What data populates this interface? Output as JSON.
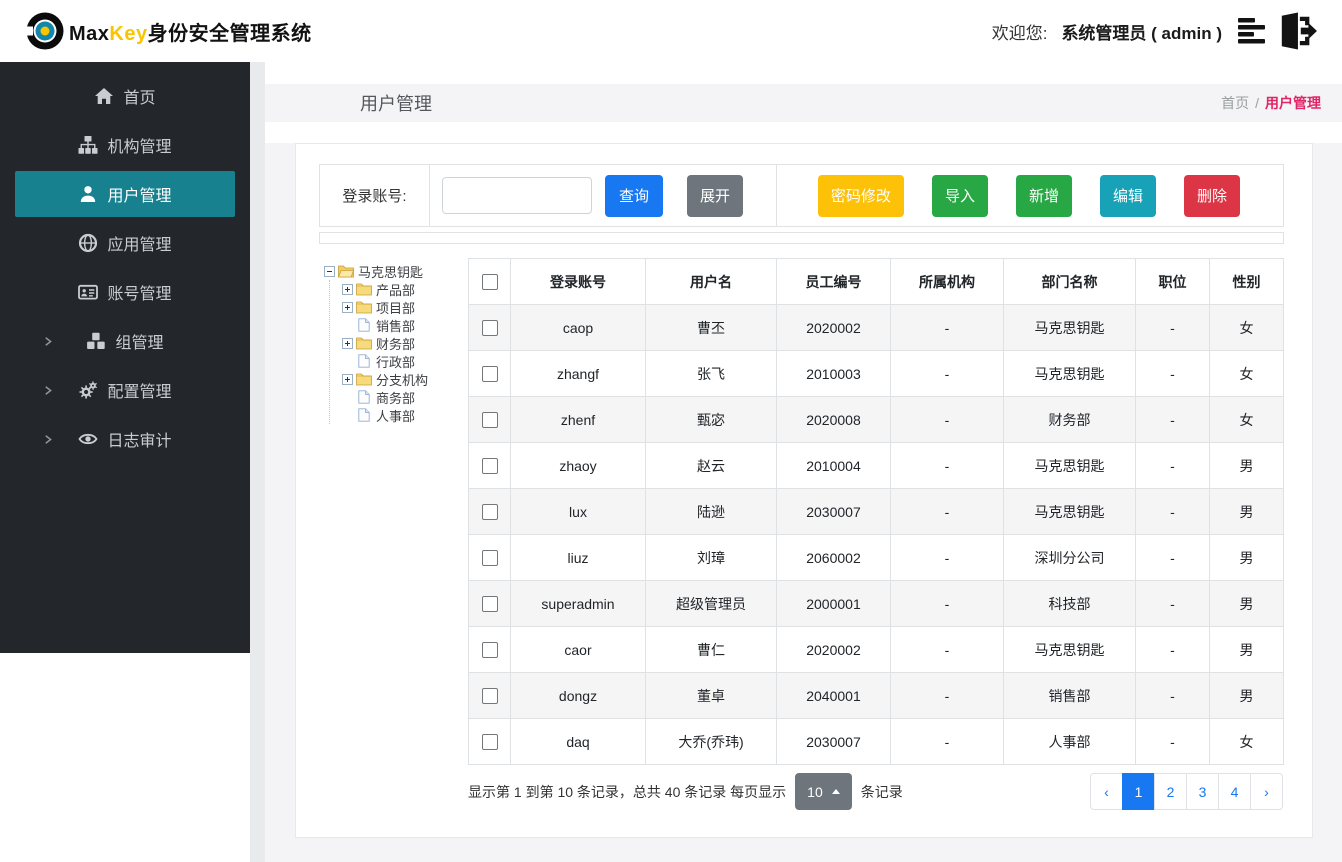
{
  "colors": {
    "brand_gold": "#f9c400",
    "logo_teal": "#1287a8",
    "logo_yellow": "#f9c400",
    "sidebar_bg": "#23272b",
    "sidebar_active": "#17818f",
    "primary_blue": "#1778f2",
    "secondary_gray": "#6e757d",
    "warning_yellow": "#fdc107",
    "success_green": "#28a745",
    "info_teal": "#17a2b8",
    "danger_red": "#dc3545",
    "breadcrumb_active": "#e02566",
    "band_bg": "#f4f4f6",
    "wrapper_bg": "#f4f4f6",
    "stripe_bg": "#f5f5f6"
  },
  "header": {
    "brand": {
      "max": "Max",
      "key": "Key",
      "suffix": "身份安全管理系统"
    },
    "welcome_label": "欢迎您:",
    "user": "系统管理员 ( admin )",
    "icons": [
      "menu-lines-icon",
      "logout-icon"
    ]
  },
  "sidebar": {
    "items": [
      {
        "key": "home",
        "label": "首页",
        "icon": "home-icon",
        "active": false,
        "has_submenu": false
      },
      {
        "key": "org",
        "label": "机构管理",
        "icon": "sitemap-icon",
        "active": false,
        "has_submenu": false
      },
      {
        "key": "user",
        "label": "用户管理",
        "icon": "user-icon",
        "active": true,
        "has_submenu": false
      },
      {
        "key": "app",
        "label": "应用管理",
        "icon": "globe-icon",
        "active": false,
        "has_submenu": false
      },
      {
        "key": "account",
        "label": "账号管理",
        "icon": "id-card-icon",
        "active": false,
        "has_submenu": false
      },
      {
        "key": "group",
        "label": "组管理",
        "icon": "cubes-icon",
        "active": false,
        "has_submenu": true
      },
      {
        "key": "config",
        "label": "配置管理",
        "icon": "gears-icon",
        "active": false,
        "has_submenu": true
      },
      {
        "key": "audit",
        "label": "日志审计",
        "icon": "eye-icon",
        "active": false,
        "has_submenu": true
      }
    ]
  },
  "page": {
    "title": "用户管理",
    "breadcrumb": {
      "home": "首页",
      "separator": "/",
      "current": "用户管理"
    }
  },
  "toolbar": {
    "search_label": "登录账号:",
    "search_value": "",
    "query_label": "查询",
    "expand_label": "展开",
    "actions": [
      {
        "key": "password-change",
        "label": "密码修改",
        "color": "#fdc107"
      },
      {
        "key": "import",
        "label": "导入",
        "color": "#28a745"
      },
      {
        "key": "add",
        "label": "新增",
        "color": "#28a745"
      },
      {
        "key": "edit",
        "label": "编辑",
        "color": "#17a2b8"
      },
      {
        "key": "delete",
        "label": "删除",
        "color": "#dc3545"
      }
    ]
  },
  "tree": {
    "nodes": [
      {
        "label": "马克思钥匙",
        "icon": "folder-open-icon",
        "expander": "minus",
        "level": 0
      },
      {
        "label": "产品部",
        "icon": "folder-icon",
        "expander": "plus",
        "level": 1
      },
      {
        "label": "项目部",
        "icon": "folder-icon",
        "expander": "plus",
        "level": 1
      },
      {
        "label": "销售部",
        "icon": "file-icon",
        "expander": "none",
        "level": 1
      },
      {
        "label": "财务部",
        "icon": "folder-icon",
        "expander": "plus",
        "level": 1
      },
      {
        "label": "行政部",
        "icon": "file-icon",
        "expander": "none",
        "level": 1
      },
      {
        "label": "分支机构",
        "icon": "folder-icon",
        "expander": "plus",
        "level": 1
      },
      {
        "label": "商务部",
        "icon": "file-icon",
        "expander": "none",
        "level": 1
      },
      {
        "label": "人事部",
        "icon": "file-icon",
        "expander": "none",
        "level": 1
      }
    ]
  },
  "table": {
    "columns": [
      "登录账号",
      "用户名",
      "员工编号",
      "所属机构",
      "部门名称",
      "职位",
      "性别"
    ],
    "rows": [
      [
        "caop",
        "曹丕",
        "2020002",
        "-",
        "马克思钥匙",
        "-",
        "女"
      ],
      [
        "zhangf",
        "张飞",
        "2010003",
        "-",
        "马克思钥匙",
        "-",
        "女"
      ],
      [
        "zhenf",
        "甄宓",
        "2020008",
        "-",
        "财务部",
        "-",
        "女"
      ],
      [
        "zhaoy",
        "赵云",
        "2010004",
        "-",
        "马克思钥匙",
        "-",
        "男"
      ],
      [
        "lux",
        "陆逊",
        "2030007",
        "-",
        "马克思钥匙",
        "-",
        "男"
      ],
      [
        "liuz",
        "刘璋",
        "2060002",
        "-",
        "深圳分公司",
        "-",
        "男"
      ],
      [
        "superadmin",
        "超级管理员",
        "2000001",
        "-",
        "科技部",
        "-",
        "男"
      ],
      [
        "caor",
        "曹仁",
        "2020002",
        "-",
        "马克思钥匙",
        "-",
        "男"
      ],
      [
        "dongz",
        "董卓",
        "2040001",
        "-",
        "销售部",
        "-",
        "男"
      ],
      [
        "daq",
        "大乔(乔玮)",
        "2030007",
        "-",
        "人事部",
        "-",
        "女"
      ]
    ]
  },
  "pagination": {
    "summary_prefix": "显示第 1 到第 10 条记录，总共 40 条记录 每页显示",
    "page_size": "10",
    "summary_suffix": "条记录",
    "prev_label": "‹",
    "next_label": "›",
    "pages": [
      "1",
      "2",
      "3",
      "4"
    ],
    "active_page": "1"
  }
}
